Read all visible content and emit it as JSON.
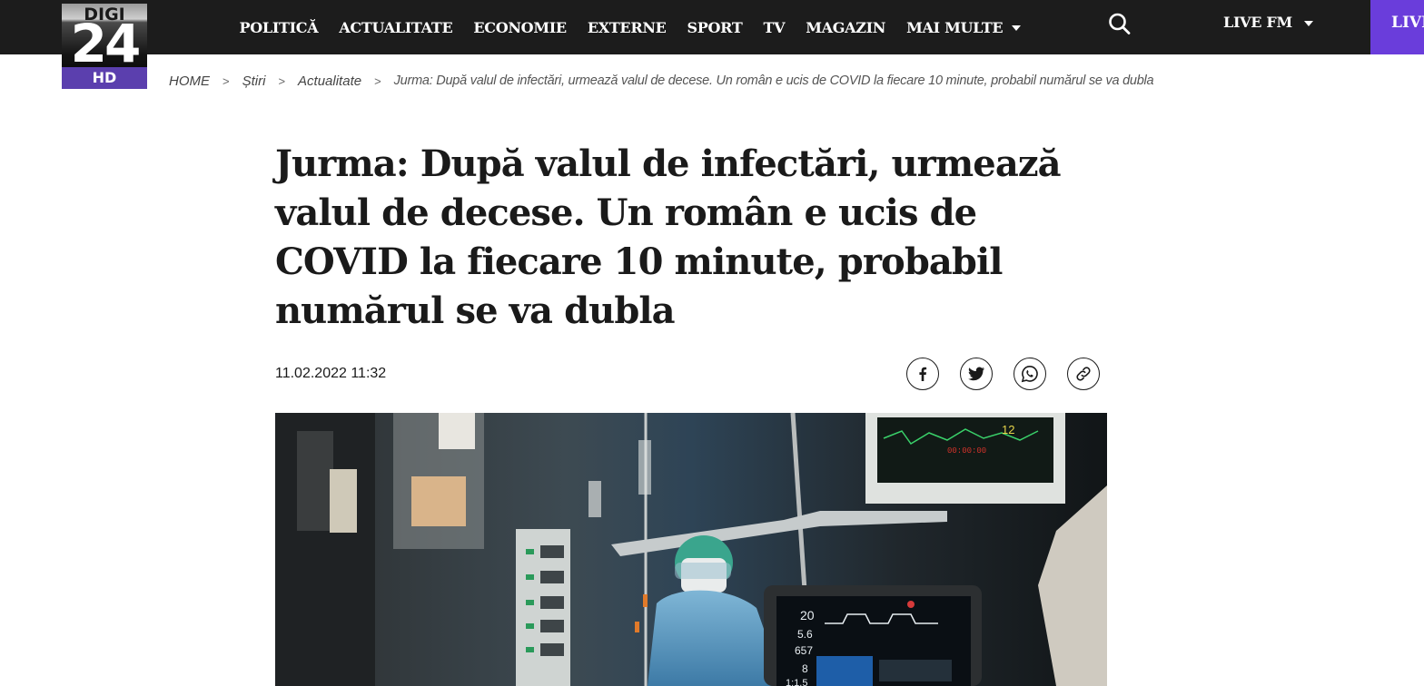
{
  "logo": {
    "top": "DIGI",
    "number": "24",
    "badge": "HD"
  },
  "nav": {
    "items": [
      "POLITICĂ",
      "ACTUALITATE",
      "ECONOMIE",
      "EXTERNE",
      "SPORT",
      "TV",
      "MAGAZIN"
    ],
    "more_label": "MAI MULTE",
    "search_icon": "search-icon",
    "live_fm_label": "LIVE FM",
    "live_label": "LIVE"
  },
  "breadcrumb": {
    "items": [
      "HOME",
      "Știri",
      "Actualitate"
    ],
    "separator": ">",
    "current": "Jurma: După valul de infectări, urmează valul de decese. Un român e ucis de COVID la fiecare 10 minute, probabil numărul se va dubla"
  },
  "article": {
    "title": "Jurma: După valul de infectări, urmează valul de decese. Un român e ucis de COVID la fiecare 10 minute, probabil numărul se va dubla",
    "date": "11.02.2022 11:32",
    "share_icons": [
      "facebook-icon",
      "twitter-icon",
      "whatsapp-icon",
      "link-icon"
    ],
    "image": {
      "monitor_values": [
        "20",
        "5.6",
        "657",
        "8",
        "1:1.5"
      ],
      "top_monitor_value": "12",
      "top_monitor_time": "00:00:00"
    }
  },
  "colors": {
    "topbar": "#1c1c1c",
    "live_accent": "#6a3ddb",
    "hd_badge": "#5b3fae"
  }
}
